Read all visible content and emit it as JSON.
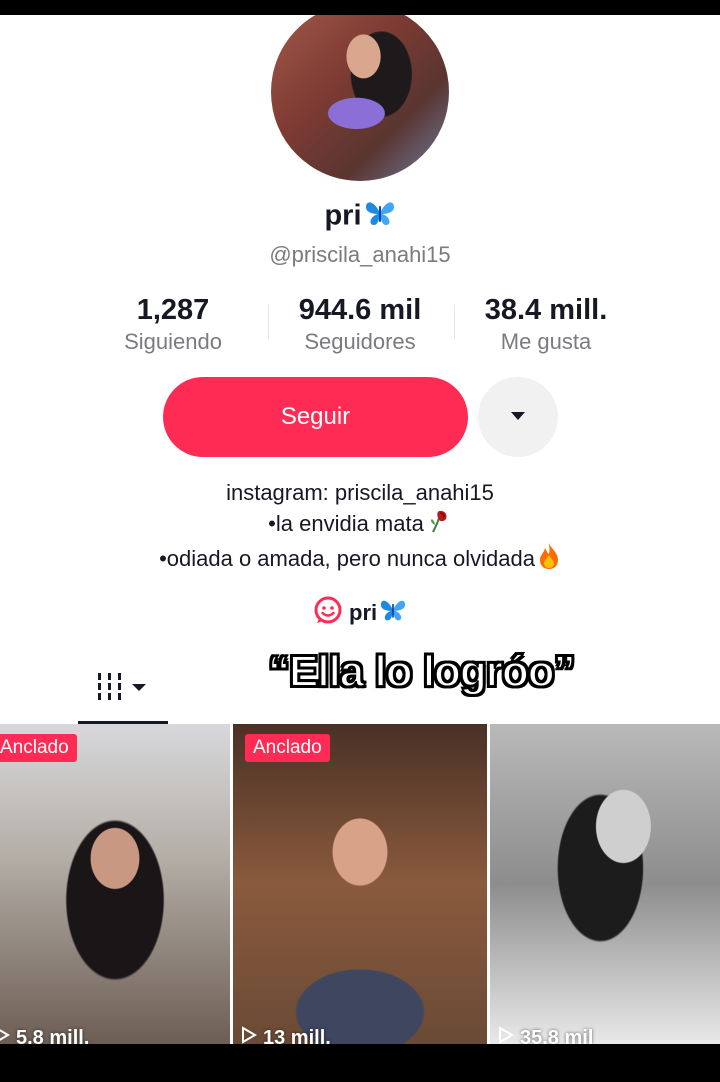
{
  "profile": {
    "display_name": "pri",
    "name_emoji": "butterfly-emoji",
    "handle": "@priscila_anahi15"
  },
  "stats": [
    {
      "value": "1,287",
      "label": "Siguiendo"
    },
    {
      "value": "944.6 mil",
      "label": "Seguidores"
    },
    {
      "value": "38.4 mill.",
      "label": "Me gusta"
    }
  ],
  "actions": {
    "follow_label": "Seguir",
    "more_icon": "caret-down-icon"
  },
  "bio": {
    "line1": "instagram: priscila_anahi15",
    "line2": "•la envidia mata",
    "line2_emoji": "wilted-rose-emoji",
    "line3": "•odiada o amada, pero nunca olvidada",
    "line3_emoji": "fire-emoji"
  },
  "linked_account": {
    "name": "pri",
    "icon": "linked-account-icon"
  },
  "overlay_caption": "“Ella lo logróo”",
  "videos": [
    {
      "badge": "Anclado",
      "views": "5.8 mill."
    },
    {
      "badge": "Anclado",
      "views": "13 mill."
    },
    {
      "badge": "",
      "views": "35.8 mil"
    }
  ],
  "colors": {
    "accent": "#fe2c55",
    "text": "#161823",
    "secondary_text": "#7a7b80"
  }
}
